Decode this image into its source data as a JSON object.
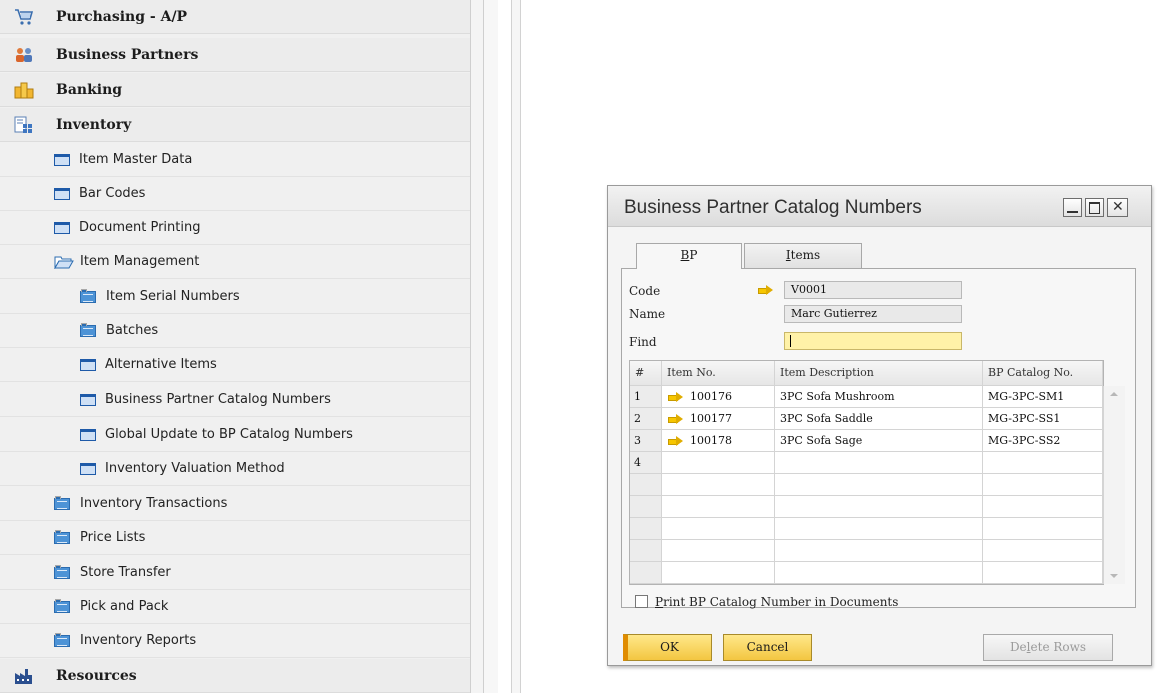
{
  "nav": {
    "top_items": [
      {
        "label": "Purchasing - A/P",
        "icon": "shopping-cart-icon"
      },
      {
        "label": "Business Partners",
        "icon": "business-partners-icon"
      },
      {
        "label": "Banking",
        "icon": "banking-coins-icon"
      },
      {
        "label": "Inventory",
        "icon": "inventory-icon"
      }
    ],
    "inventory_items": [
      {
        "label": "Item Master Data",
        "icon": "window-icon"
      },
      {
        "label": "Bar Codes",
        "icon": "window-icon"
      },
      {
        "label": "Document Printing",
        "icon": "window-icon"
      },
      {
        "label": "Item Management",
        "icon": "open-folder-icon"
      }
    ],
    "item_management_items": [
      {
        "label": "Item Serial Numbers",
        "icon": "folder-icon"
      },
      {
        "label": "Batches",
        "icon": "folder-icon"
      },
      {
        "label": "Alternative Items",
        "icon": "window-icon"
      },
      {
        "label": "Business Partner Catalog Numbers",
        "icon": "window-icon"
      },
      {
        "label": "Global Update to BP Catalog Numbers",
        "icon": "window-icon"
      },
      {
        "label": "Inventory Valuation Method",
        "icon": "window-icon"
      }
    ],
    "inventory_folders": [
      {
        "label": "Inventory Transactions",
        "icon": "folder-icon"
      },
      {
        "label": "Price Lists",
        "icon": "folder-icon"
      },
      {
        "label": "Store Transfer",
        "icon": "folder-icon"
      },
      {
        "label": "Pick and Pack",
        "icon": "folder-icon"
      },
      {
        "label": "Inventory Reports",
        "icon": "folder-icon"
      }
    ],
    "bottom_item": {
      "label": "Resources",
      "icon": "resources-factory-icon"
    }
  },
  "dialog": {
    "title": "Business Partner Catalog Numbers",
    "tabs": [
      {
        "label_ul": "B",
        "label_rest": "P"
      },
      {
        "label_ul": "I",
        "label_rest": "tems"
      }
    ],
    "fields": {
      "code_label": "Code",
      "code_value": "V0001",
      "name_label": "Name",
      "name_value": "Marc Gutierrez",
      "find_label": "Find",
      "find_value": ""
    },
    "table": {
      "columns": [
        "#",
        "Item No.",
        "Item Description",
        "BP Catalog No."
      ],
      "rows": [
        {
          "num": "1",
          "item_no": "100176",
          "description": "3PC Sofa Mushroom",
          "bp_catalog": "MG-3PC-SM1"
        },
        {
          "num": "2",
          "item_no": "100177",
          "description": "3PC Sofa Saddle",
          "bp_catalog": "MG-3PC-SS1"
        },
        {
          "num": "3",
          "item_no": "100178",
          "description": "3PC Sofa Sage",
          "bp_catalog": "MG-3PC-SS2"
        },
        {
          "num": "4",
          "item_no": "",
          "description": "",
          "bp_catalog": ""
        },
        {
          "num": "",
          "item_no": "",
          "description": "",
          "bp_catalog": ""
        },
        {
          "num": "",
          "item_no": "",
          "description": "",
          "bp_catalog": ""
        },
        {
          "num": "",
          "item_no": "",
          "description": "",
          "bp_catalog": ""
        },
        {
          "num": "",
          "item_no": "",
          "description": "",
          "bp_catalog": ""
        },
        {
          "num": "",
          "item_no": "",
          "description": "",
          "bp_catalog": ""
        }
      ]
    },
    "checkbox": {
      "label_ul": "P",
      "label_rest": "rint BP Catalog Number in Documents",
      "checked": false
    },
    "buttons": {
      "ok": "OK",
      "cancel": "Cancel",
      "delete_ul_pre": "De",
      "delete_ul": "l",
      "delete_post": "ete Rows"
    }
  },
  "colors": {
    "accent_yellow": "#f3c641",
    "find_field": "#fff2a8",
    "folder_blue": "#4d93d6"
  }
}
